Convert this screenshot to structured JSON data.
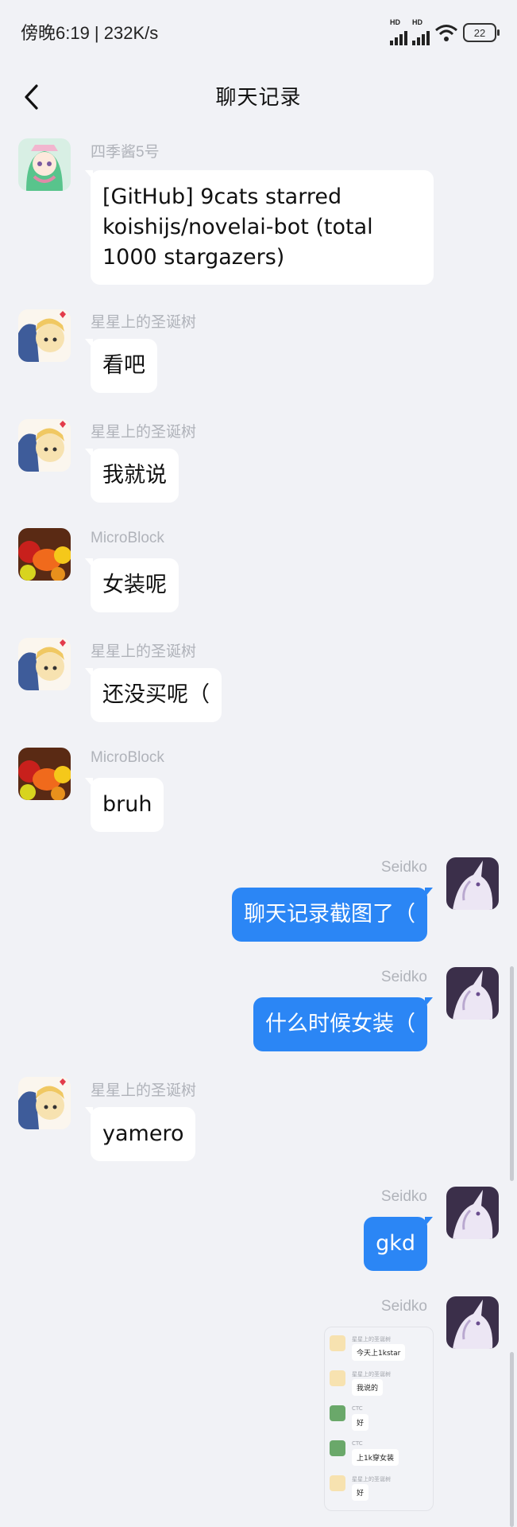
{
  "status_bar": {
    "time_speed": "傍晚6:19 | 232K/s",
    "network1": "HD",
    "network2": "HD",
    "battery": "22"
  },
  "nav": {
    "title": "聊天记录",
    "back_icon": "chevron-left-icon"
  },
  "messages": [
    {
      "sender": "四季酱5号",
      "text": "[GitHub] 9cats starred koishijs/novelai-bot (total 1000 stargazers)",
      "side": "in",
      "avatar": "anime-girl-green-hair"
    },
    {
      "sender": "星星上的圣诞树",
      "text": "看吧",
      "side": "in",
      "avatar": "anime-duo"
    },
    {
      "sender": "星星上的圣诞树",
      "text": "我就说",
      "side": "in",
      "avatar": "anime-duo"
    },
    {
      "sender": "MicroBlock",
      "text": "女装呢",
      "side": "in",
      "avatar": "fruits"
    },
    {
      "sender": "星星上的圣诞树",
      "text": "还没买呢（",
      "side": "in",
      "avatar": "anime-duo"
    },
    {
      "sender": "MicroBlock",
      "text": "bruh",
      "side": "in",
      "avatar": "fruits"
    },
    {
      "sender": "Seidko",
      "text": "聊天记录截图了（",
      "side": "out",
      "avatar": "white-dragon"
    },
    {
      "sender": "Seidko",
      "text": "什么时候女装（",
      "side": "out",
      "avatar": "white-dragon"
    },
    {
      "sender": "星星上的圣诞树",
      "text": "yamero",
      "side": "in",
      "avatar": "anime-duo"
    },
    {
      "sender": "Seidko",
      "text": "gkd",
      "side": "out",
      "avatar": "white-dragon"
    },
    {
      "sender": "Seidko",
      "text": "",
      "side": "out",
      "avatar": "white-dragon",
      "type": "image"
    }
  ],
  "image_preview": {
    "rows": [
      {
        "name": "星星上的圣诞树",
        "text": "今天上1kstar"
      },
      {
        "name": "星星上的圣诞树",
        "text": "我说的"
      },
      {
        "name": "CTC",
        "text": "好"
      },
      {
        "name": "CTC",
        "text": "上1k穿女装"
      },
      {
        "name": "星星上的圣诞树",
        "text": "好"
      }
    ]
  },
  "colors": {
    "background": "#f1f2f6",
    "outgoing_bubble": "#2b86f5",
    "incoming_bubble": "#ffffff",
    "sender_text": "#b0b3ba"
  }
}
